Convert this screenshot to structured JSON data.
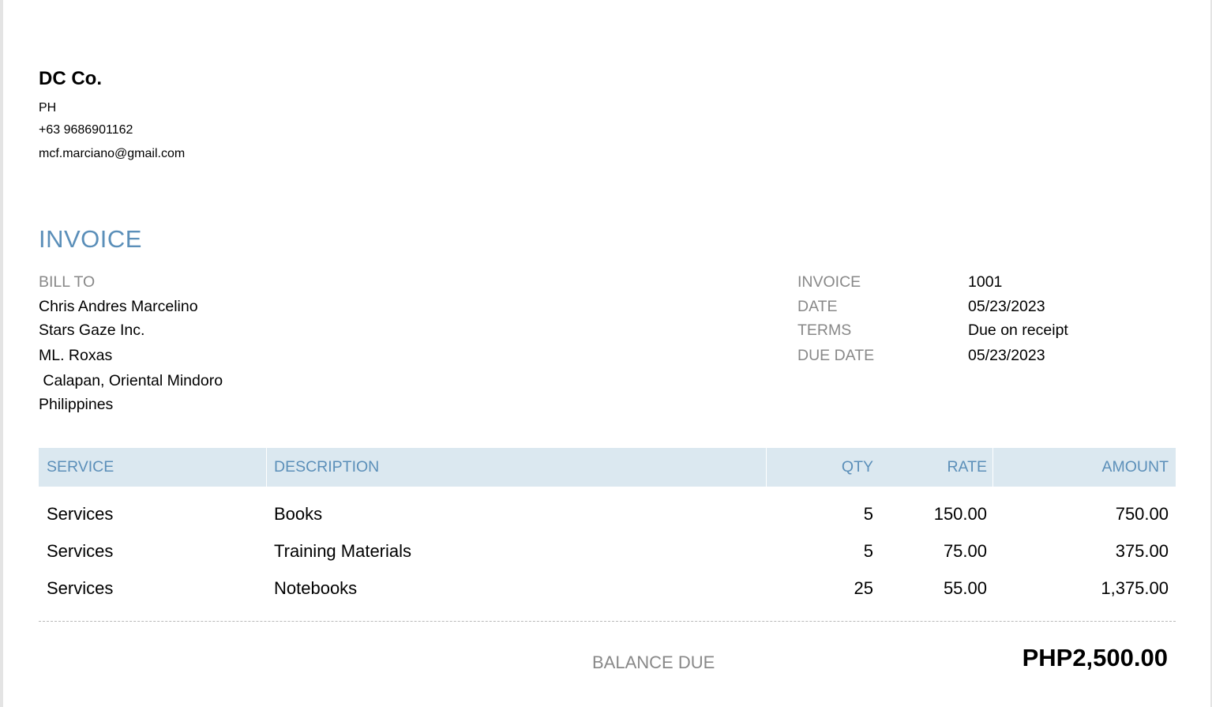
{
  "company": {
    "name": "DC Co.",
    "country": "PH",
    "phone": "+63 9686901162",
    "email": "mcf.marciano@gmail.com"
  },
  "title": "INVOICE",
  "bill_to": {
    "label": "BILL TO",
    "lines": [
      "Chris Andres Marcelino",
      "Stars Gaze Inc.",
      "ML. Roxas",
      " Calapan, Oriental Mindoro",
      "Philippines"
    ]
  },
  "meta": [
    {
      "label": "INVOICE",
      "value": "1001"
    },
    {
      "label": "DATE",
      "value": "05/23/2023"
    },
    {
      "label": "TERMS",
      "value": "Due on receipt"
    },
    {
      "label": "DUE DATE",
      "value": "05/23/2023"
    }
  ],
  "table": {
    "headers": {
      "service": "SERVICE",
      "description": "DESCRIPTION",
      "qty": "QTY",
      "rate": "RATE",
      "amount": "AMOUNT"
    },
    "rows": [
      {
        "service": "Services",
        "description": "Books",
        "qty": "5",
        "rate": "150.00",
        "amount": "750.00"
      },
      {
        "service": "Services",
        "description": "Training Materials",
        "qty": "5",
        "rate": "75.00",
        "amount": "375.00"
      },
      {
        "service": "Services",
        "description": "Notebooks",
        "qty": "25",
        "rate": "55.00",
        "amount": "1,375.00"
      }
    ]
  },
  "balance": {
    "label": "BALANCE DUE",
    "value": "PHP2,500.00"
  },
  "colors": {
    "accent": "#5b8fb9",
    "header_bg": "#dbe8f0",
    "label_gray": "#888888"
  }
}
